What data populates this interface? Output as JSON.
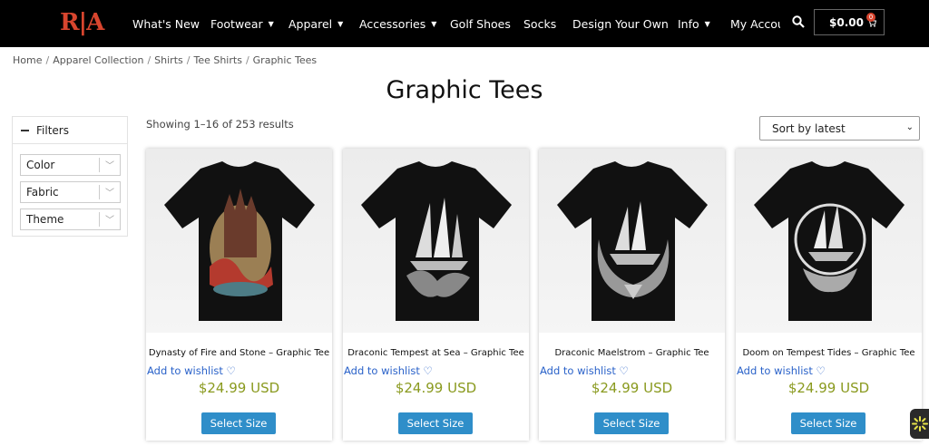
{
  "header": {
    "logo": "R|A",
    "nav": [
      {
        "label": "What's New",
        "dropdown": false
      },
      {
        "label": "Footwear",
        "dropdown": true
      },
      {
        "label": "Apparel",
        "dropdown": true
      },
      {
        "label": "Accessories",
        "dropdown": true
      },
      {
        "label": "Golf Shoes",
        "dropdown": false
      },
      {
        "label": "Socks",
        "dropdown": false
      },
      {
        "label": "Design Your Own",
        "dropdown": false
      },
      {
        "label": "Info",
        "dropdown": true
      },
      {
        "label": "My Accou",
        "dropdown": false
      }
    ],
    "cart_total": "$0.00",
    "cart_count": "0",
    "search_icon": "search-icon",
    "cart_icon": "cart-icon"
  },
  "breadcrumb": [
    "Home",
    "Apparel Collection",
    "Shirts",
    "Tee Shirts",
    "Graphic Tees"
  ],
  "page_title": "Graphic Tees",
  "filters": {
    "title": "Filters",
    "options": [
      "Color",
      "Fabric",
      "Theme"
    ]
  },
  "results_text": "Showing 1–16 of 253 results",
  "sort": {
    "selected": "Sort by latest"
  },
  "products": [
    {
      "name": "Dynasty of Fire and Stone – Graphic Tee",
      "wishlist": "Add to wishlist ♡",
      "price": "$24.99 USD",
      "button": "Select Size"
    },
    {
      "name": "Draconic Tempest at Sea – Graphic Tee",
      "wishlist": "Add to wishlist ♡",
      "price": "$24.99 USD",
      "button": "Select Size"
    },
    {
      "name": "Draconic Maelstrom – Graphic Tee",
      "wishlist": "Add to wishlist ♡",
      "price": "$24.99 USD",
      "button": "Select Size"
    },
    {
      "name": "Doom on Tempest Tides – Graphic Tee",
      "wishlist": "Add to wishlist ♡",
      "price": "$24.99 USD",
      "button": "Select Size"
    }
  ],
  "colors": {
    "header_bg": "#000000",
    "logo": "#d8452e",
    "price": "#8a9a1f",
    "button": "#2f8ec9",
    "link": "#2a62c9"
  }
}
